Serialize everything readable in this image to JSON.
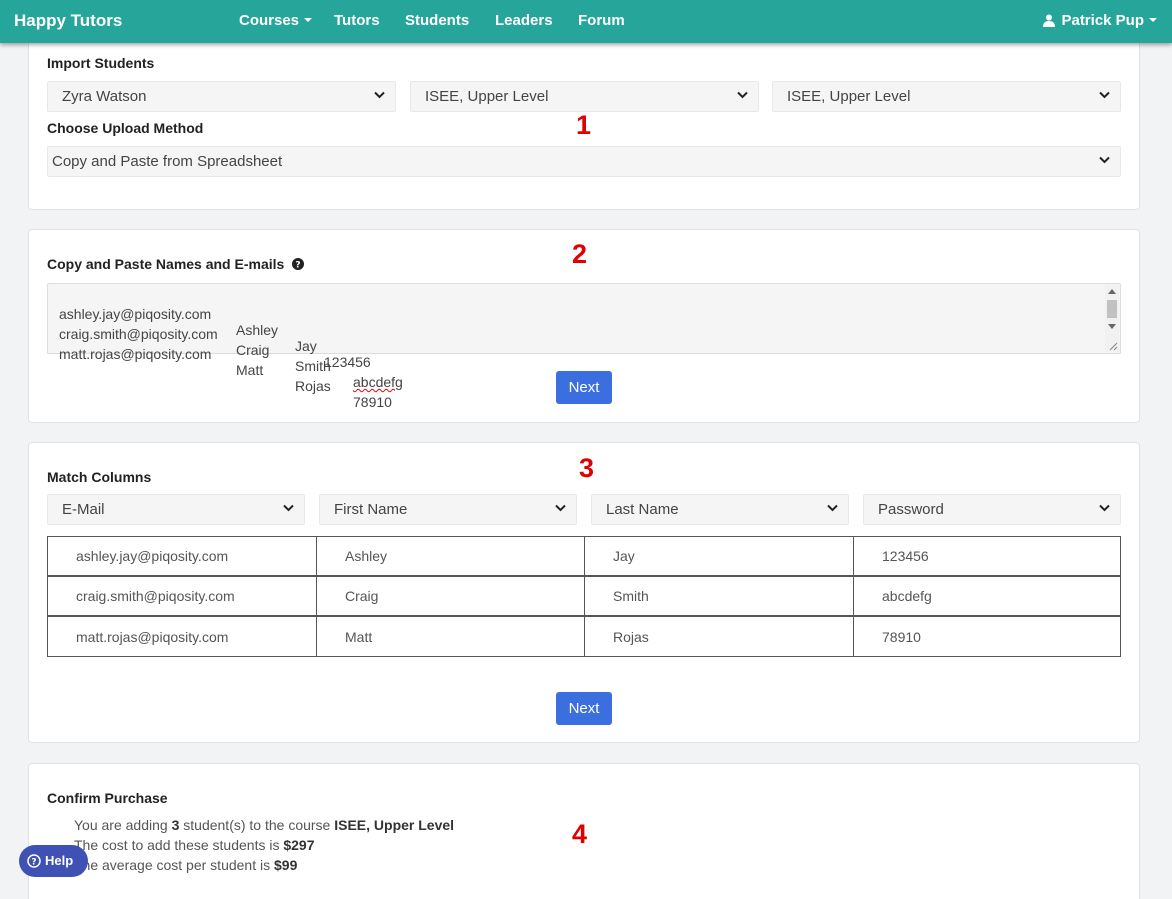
{
  "navbar": {
    "brand": "Happy Tutors",
    "links": [
      "Courses",
      "Tutors",
      "Students",
      "Leaders",
      "Forum"
    ],
    "user": "Patrick Pup"
  },
  "import": {
    "title": "Import Students",
    "selects": [
      "Zyra Watson",
      "ISEE, Upper Level",
      "ISEE, Upper Level"
    ],
    "method_label": "Choose Upload Method",
    "method_value": "Copy and Paste from Spreadsheet",
    "step": "1"
  },
  "paste": {
    "title": "Copy and Paste Names and E-mails",
    "step": "2",
    "rows": [
      [
        "ashley.jay@piqosity.com",
        "Ashley",
        "Jay",
        "123456"
      ],
      [
        "craig.smith@piqosity.com",
        "Craig",
        "Smith",
        "abcdefg"
      ],
      [
        "matt.rojas@piqosity.com",
        "Matt",
        "Rojas",
        "78910"
      ]
    ],
    "next_label": "Next"
  },
  "match": {
    "title": "Match Columns",
    "step": "3",
    "columns": [
      "E-Mail",
      "First Name",
      "Last Name",
      "Password"
    ],
    "rows": [
      [
        "ashley.jay@piqosity.com",
        "Ashley",
        "Jay",
        "123456"
      ],
      [
        "craig.smith@piqosity.com",
        "Craig",
        "Smith",
        "abcdefg"
      ],
      [
        "matt.rojas@piqosity.com",
        "Matt",
        "Rojas",
        "78910"
      ]
    ],
    "next_label": "Next"
  },
  "confirm": {
    "title": "Confirm Purchase",
    "step": "4",
    "line1_pre": "You are adding ",
    "count": "3",
    "line1_mid": " student(s) to the course ",
    "course": "ISEE, Upper Level",
    "line2_pre": "The cost to add these students is ",
    "total": "$297",
    "line3_pre": "The average cost per student is ",
    "avg": "$99"
  },
  "help": {
    "label": "Help"
  },
  "colors": {
    "nav": "#26a69a",
    "button": "#3b6fe0",
    "step": "#e00000",
    "help": "#3f51b5"
  },
  "icons": [
    "caret-down-icon",
    "user-icon",
    "question-circle-icon",
    "chevron-down-icon",
    "help-icon"
  ]
}
